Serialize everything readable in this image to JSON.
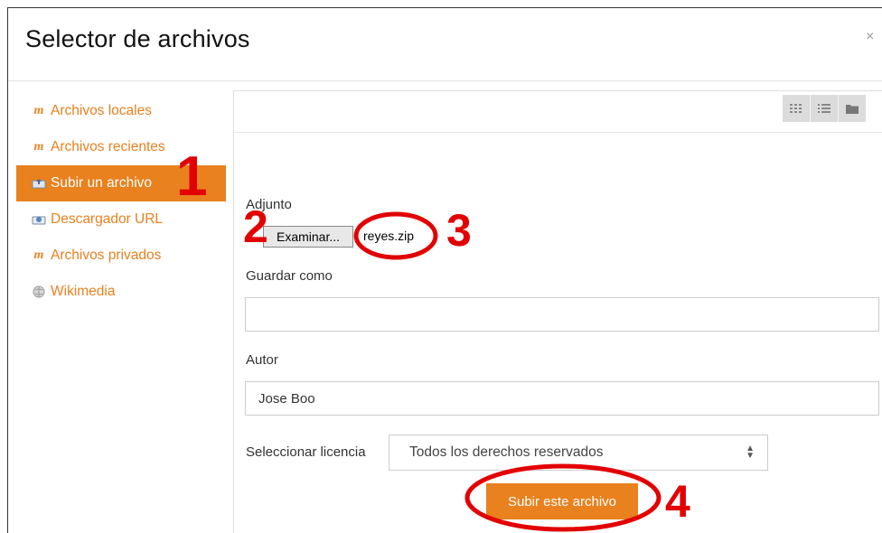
{
  "dialog": {
    "title": "Selector de archivos",
    "close_label": "×"
  },
  "sidebar": {
    "items": [
      {
        "label": "Archivos locales",
        "icon": "moodle-icon",
        "active": false
      },
      {
        "label": "Archivos recientes",
        "icon": "moodle-icon",
        "active": false
      },
      {
        "label": "Subir un archivo",
        "icon": "upload-icon",
        "active": true
      },
      {
        "label": "Descargador URL",
        "icon": "url-download-icon",
        "active": false
      },
      {
        "label": "Archivos privados",
        "icon": "moodle-icon",
        "active": false
      },
      {
        "label": "Wikimedia",
        "icon": "wikimedia-globe-icon",
        "active": false
      }
    ]
  },
  "toolbar": {
    "view_buttons": [
      "icons-view-icon",
      "list-view-icon",
      "folder-view-icon"
    ]
  },
  "form": {
    "attachment_label": "Adjunto",
    "browse_button": "Examinar...",
    "selected_file": "reyes.zip",
    "save_as_label": "Guardar como",
    "save_as_value": "",
    "author_label": "Autor",
    "author_value": "Jose Boo",
    "license_label": "Seleccionar licencia",
    "license_value": "Todos los derechos reservados",
    "submit_label": "Subir este archivo"
  },
  "annotations": {
    "step1": "1",
    "step2": "2",
    "step3": "3",
    "step4": "4",
    "color": "#e20000"
  },
  "colors": {
    "accent": "#e8811e"
  }
}
